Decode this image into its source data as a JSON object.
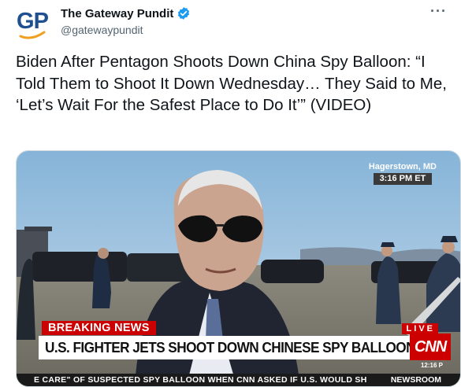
{
  "author": {
    "avatar_text": "GP",
    "name": "The Gateway Pundit",
    "handle": "@gatewaypundit",
    "verified": true
  },
  "more_label": "···",
  "tweet_text": "Biden After Pentagon Shoots Down China Spy Balloon: “I Told Them to Shoot It Down Wednesday… They Said to Me, ‘Let’s Wait For the Safest Place to Do It’” (VIDEO)",
  "video": {
    "location": "Hagerstown, MD",
    "time": "3:16 PM ET",
    "breaking_label": "BREAKING NEWS",
    "live_label": "LIVE",
    "headline": "U.S. FIGHTER JETS SHOOT DOWN CHINESE SPY BALLOON",
    "network": "CNN",
    "corner_time": "12:16 P",
    "ticker": "E CARE\" OF SUSPECTED SPY BALLOON WHEN CNN ASKED IF U.S. WOULD SH",
    "ticker_tag": "NEWSROOM"
  },
  "colors": {
    "verified": "#1d9bf0",
    "gp_blue": "#1f4f8e",
    "gp_orange": "#f0a020",
    "cnn_red": "#cc0000"
  },
  "icons": {
    "verified": "verified-badge-icon",
    "more": "more-options-icon"
  }
}
